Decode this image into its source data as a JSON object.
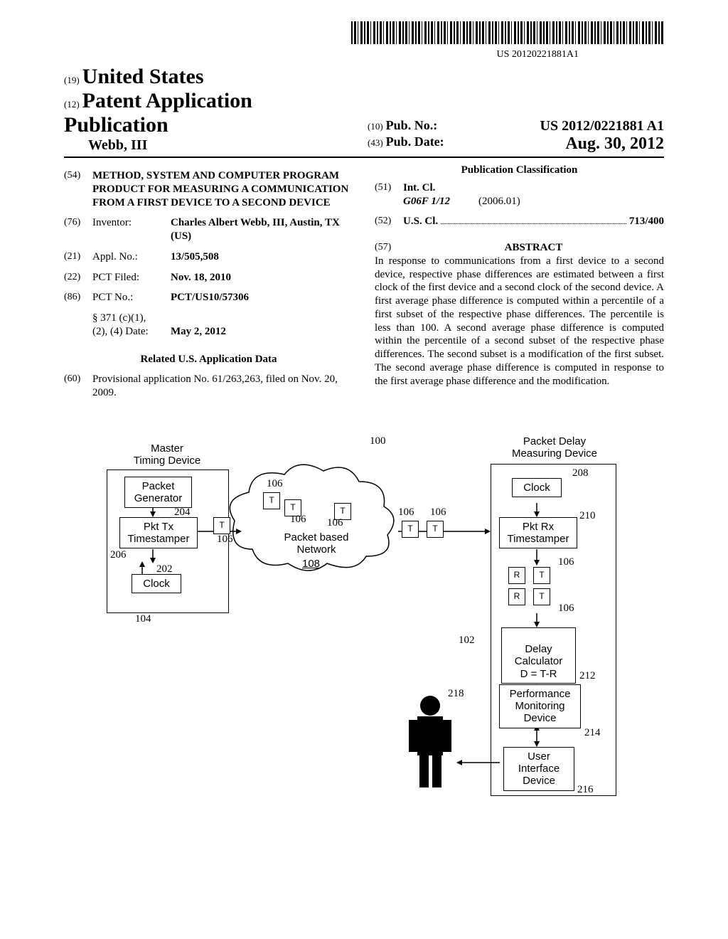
{
  "barcode_number": "US 20120221881A1",
  "header": {
    "country_code": "(19)",
    "country": "United States",
    "pub_type_code": "(12)",
    "pub_type": "Patent Application Publication",
    "author": "Webb, III",
    "pubno_code": "(10)",
    "pubno_label": "Pub. No.:",
    "pubno": "US 2012/0221881 A1",
    "pubdate_code": "(43)",
    "pubdate_label": "Pub. Date:",
    "pubdate": "Aug. 30, 2012"
  },
  "left": {
    "title_code": "(54)",
    "title": "METHOD, SYSTEM AND COMPUTER PROGRAM PRODUCT FOR MEASURING A COMMUNICATION FROM A FIRST DEVICE TO A SECOND DEVICE",
    "inventor_code": "(76)",
    "inventor_label": "Inventor:",
    "inventor_val": "Charles Albert Webb, III, Austin, TX (US)",
    "applno_code": "(21)",
    "applno_label": "Appl. No.:",
    "applno_val": "13/505,508",
    "pctfiled_code": "(22)",
    "pctfiled_label": "PCT Filed:",
    "pctfiled_val": "Nov. 18, 2010",
    "pctno_code": "(86)",
    "pctno_label": "PCT No.:",
    "pctno_val": "PCT/US10/57306",
    "s371_label": "§ 371 (c)(1),",
    "s371_date_label": "(2), (4) Date:",
    "s371_date_val": "May 2, 2012",
    "related_head": "Related U.S. Application Data",
    "prov_code": "(60)",
    "prov_text": "Provisional application No. 61/263,263, filed on Nov. 20, 2009."
  },
  "right": {
    "class_head": "Publication Classification",
    "intcl_code": "(51)",
    "intcl_label": "Int. Cl.",
    "intcl_class": "G06F 1/12",
    "intcl_date": "(2006.01)",
    "uscl_code": "(52)",
    "uscl_label": "U.S. Cl.",
    "uscl_val": "713/400",
    "abs_code": "(57)",
    "abs_head": "ABSTRACT",
    "abs_text": "In response to communications from a first device to a second device, respective phase differences are estimated between a first clock of the first device and a second clock of the second device. A first average phase difference is computed within a percentile of a first subset of the respective phase differences. The percentile is less than 100. A second average phase difference is computed within the percentile of a second subset of the respective phase differences. The second subset is a modification of the first subset. The second average phase difference is computed in response to the first average phase difference and the modification."
  },
  "figure": {
    "master_label": "Master\nTiming Device",
    "pkt_gen": "Packet\nGenerator",
    "pkt_tx": "Pkt Tx\nTimestamper",
    "clock": "Clock",
    "network": "Packet based\nNetwork",
    "net_ref": "108",
    "pdm_label": "Packet Delay\nMeasuring Device",
    "pkt_rx": "Pkt Rx\nTimestamper",
    "delay_calc": "Delay\nCalculator\nD = T-R",
    "perf_mon": "Performance\nMonitoring\nDevice",
    "ui_dev": "User\nInterface\nDevice",
    "refs": {
      "r100": "100",
      "r102": "102",
      "r104": "104",
      "r106": "106",
      "r202": "202",
      "r204": "204",
      "r206": "206",
      "r208": "208",
      "r210": "210",
      "r212": "212",
      "r214": "214",
      "r216": "216",
      "r218": "218"
    },
    "T": "T",
    "R": "R"
  }
}
